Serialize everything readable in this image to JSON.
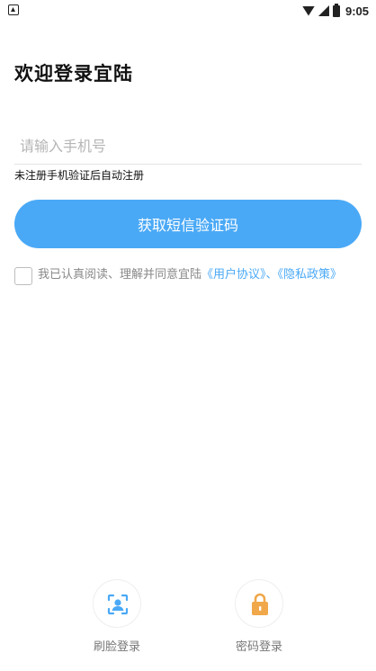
{
  "status_bar": {
    "time": "9:05"
  },
  "title": "欢迎登录宜陆",
  "phone_input": {
    "placeholder": "请输入手机号",
    "value": ""
  },
  "hint": "未注册手机验证后自动注册",
  "sms_button": {
    "label": "获取短信验证码"
  },
  "agreement": {
    "prefix": "我已认真阅读、理解并同意宜陆",
    "user_agreement": "《用户协议》",
    "separator": "、",
    "privacy_policy": "《隐私政策》"
  },
  "alt_logins": [
    {
      "label": "刷脸登录",
      "icon": "face-scan-icon"
    },
    {
      "label": "密码登录",
      "icon": "lock-icon"
    }
  ],
  "colors": {
    "accent": "#4aa9f6",
    "lock": "#f0a84a"
  }
}
